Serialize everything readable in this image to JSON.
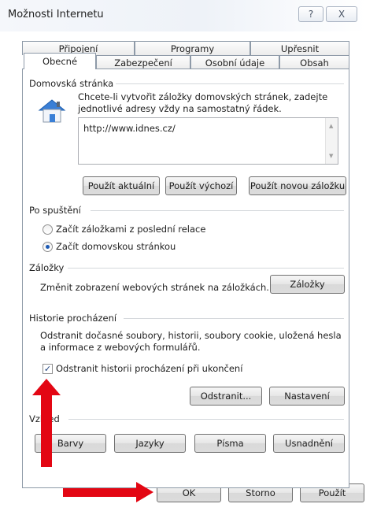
{
  "window": {
    "title": "Možnosti Internetu",
    "help_label": "?",
    "close_label": "X"
  },
  "tabs": {
    "row1": [
      "Připojení",
      "Programy",
      "Upřesnit"
    ],
    "row2": [
      "Obecné",
      "Zabezpečení",
      "Osobní údaje",
      "Obsah"
    ],
    "active": "Obecné"
  },
  "home": {
    "section_title": "Domovská stránka",
    "description_line1": "Chcete-li vytvořit záložky domovských stránek, zadejte",
    "description_line2": "jednotlivé adresy vždy na samostatný řádek.",
    "url": "http://www.idnes.cz/",
    "use_current": "Použít aktuální",
    "use_default": "Použít výchozí",
    "use_new_tab": "Použít novou záložku"
  },
  "startup": {
    "section_title": "Po spuštění",
    "option_tabs": "Začít záložkami z poslední relace",
    "option_home": "Začít domovskou stránkou",
    "selected": "home"
  },
  "tabs_section": {
    "section_title": "Záložky",
    "description": "Změnit zobrazení webových stránek na záložkách.",
    "button": "Záložky"
  },
  "history": {
    "section_title": "Historie procházení",
    "description_line1": "Odstranit dočasné soubory, historii, soubory cookie, uložená hesla",
    "description_line2": "a informace z webových formulářů.",
    "checkbox_label": "Odstranit historii procházení při ukončení",
    "checkbox_mark": "✓",
    "checked": true,
    "delete_button": "Odstranit...",
    "settings_button": "Nastavení"
  },
  "appearance": {
    "section_title": "Vzhled",
    "colors": "Barvy",
    "languages": "Jazyky",
    "fonts": "Písma",
    "accessibility": "Usnadnění"
  },
  "footer": {
    "ok": "OK",
    "cancel": "Storno",
    "apply": "Použít"
  },
  "colors": {
    "accent_arrow": "#e30613",
    "radio_selected": "#1d5ab4"
  }
}
